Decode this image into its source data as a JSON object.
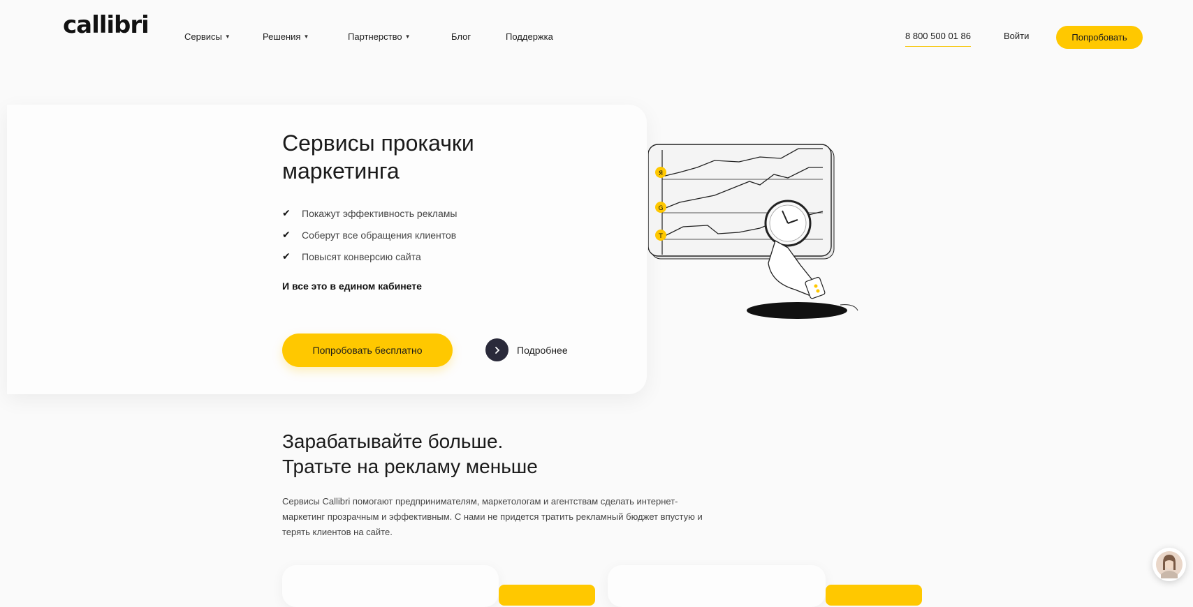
{
  "header": {
    "logo": "callibri",
    "nav": [
      {
        "label": "Сервисы",
        "has_dropdown": true
      },
      {
        "label": "Решения",
        "has_dropdown": true
      },
      {
        "label": "Партнерство",
        "has_dropdown": true
      },
      {
        "label": "Блог",
        "has_dropdown": false
      },
      {
        "label": "Поддержка",
        "has_dropdown": false
      }
    ],
    "phone": "8 800 500 01 86",
    "login": "Войти",
    "try_button": "Попробовать"
  },
  "hero": {
    "title": "Сервисы прокачки маркетинга",
    "bullets": [
      "Покажут эффективность рекламы",
      "Соберут все обращения клиентов",
      "Повысят конверсию сайта"
    ],
    "subtitle": "И все это в едином кабинете",
    "cta_label": "Попробовать бесплатно",
    "more_label": "Подробнее",
    "illustration_badges": [
      "Я",
      "G",
      "T"
    ]
  },
  "section": {
    "title_line1": "Зарабатывайте больше.",
    "title_line2": "Тратьте на рекламу меньше",
    "description": "Сервисы Callibri помогают предпринимателям, маркетологам и агентствам сделать интернет-маркетинг прозрачным и эффективным. С нами не придется тратить рекламный бюджет впустую и терять клиентов на сайте."
  },
  "colors": {
    "accent": "#ffc800",
    "dark": "#2a2a3a",
    "background": "#fafafa"
  },
  "icons": {
    "check": "check-icon",
    "arrow": "chevron-right-icon",
    "caret": "caret-down-icon"
  }
}
